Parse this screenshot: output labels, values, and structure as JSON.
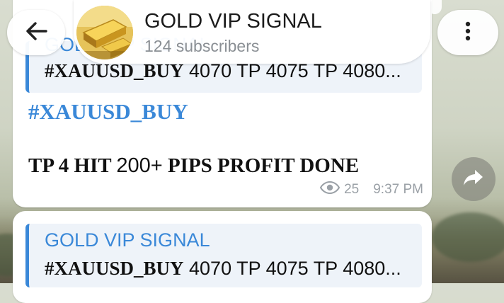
{
  "header": {
    "channel_title": "GOLD VIP SIGNAL",
    "subscribers": "124 subscribers"
  },
  "messages": [
    {
      "reply": {
        "name": "GOLD VIP SIGNAL",
        "hashtag": "#XAUUSD_BUY",
        "text": " 4070  TP 4075 TP 4080..."
      },
      "hashtag": "#XAUUSD_BUY",
      "body_prefix": "TP 4 HIT ",
      "body_mid": "200+",
      "body_suffix": " PIPS PROFIT DONE",
      "views": "25",
      "time": "9:37 PM"
    },
    {
      "reply": {
        "name": "GOLD VIP SIGNAL",
        "hashtag": "#XAUUSD_BUY",
        "text": " 4070  TP 4075 TP 4080..."
      }
    }
  ],
  "colors": {
    "accent": "#3a88d8",
    "bubble": "#ffffff",
    "meta": "#9aa0a6"
  },
  "icons": {
    "back": "arrow-left-icon",
    "menu": "more-vertical-icon",
    "share": "share-arrow-icon",
    "views": "eye-icon"
  }
}
